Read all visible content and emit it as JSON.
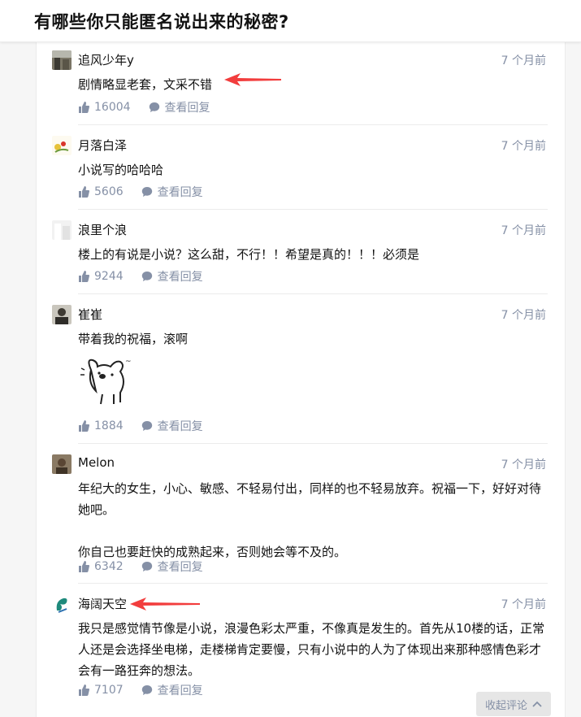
{
  "question": {
    "title": "有哪些你只能匿名说出来的秘密?"
  },
  "comments": [
    {
      "author": "追风少年y",
      "time": "7 个月前",
      "content": [
        "剧情略显老套，文采不错"
      ],
      "likes": "16004",
      "reply_label": "查看回复"
    },
    {
      "author": "月落白泽",
      "time": "7 个月前",
      "content": [
        "小说写的哈哈哈"
      ],
      "likes": "5606",
      "reply_label": "查看回复"
    },
    {
      "author": "浪里个浪",
      "time": "7 个月前",
      "content": [
        "楼上的有说是小说？这么甜，不行！！希望是真的！！！必须是"
      ],
      "likes": "9244",
      "reply_label": "查看回复"
    },
    {
      "author": "崔崔",
      "time": "7 个月前",
      "content": [
        "带着我的祝福，滚啊"
      ],
      "likes": "1884",
      "reply_label": "查看回复"
    },
    {
      "author": "Melon",
      "time": "7 个月前",
      "content": [
        "年纪大的女生，小心、敏感、不轻易付出，同样的也不轻易放弃。祝福一下，好好对待她吧。",
        "你自己也要赶快的成熟起来，否则她会等不及的。"
      ],
      "likes": "6342",
      "reply_label": "查看回复"
    },
    {
      "author": "海阔天空",
      "time": "7 个月前",
      "content": [
        "我只是感觉情节像是小说，浪漫色彩太严重，不像真是发生的。首先从10楼的话，正常人还是会选择坐电梯，走楼梯肯定要慢，只有小说中的人为了体现出来那种感情色彩才会有一路狂奔的想法。"
      ],
      "likes": "7107",
      "reply_label": "查看回复"
    }
  ],
  "collapse_label": "收起评论",
  "colors": {
    "meta": "#8590a6",
    "annotation_arrow": "#f23d3d"
  },
  "icons": {
    "like": "thumbs-up-icon",
    "reply": "comment-bubble-icon",
    "collapse": "chevron-up-icon"
  }
}
